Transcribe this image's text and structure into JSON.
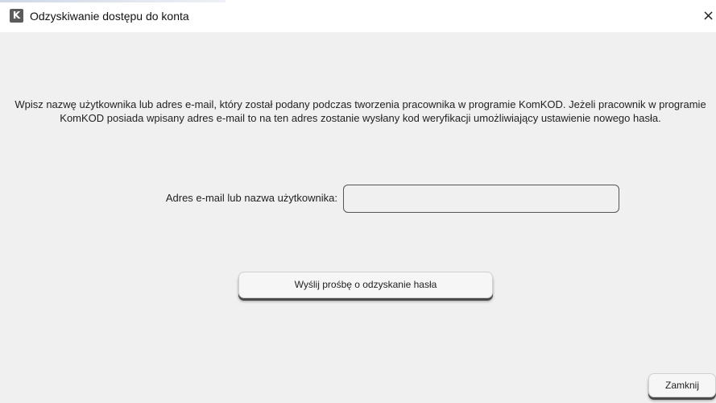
{
  "window": {
    "icon_letter": "K",
    "title": "Odzyskiwanie dostępu do konta",
    "close_glyph": "×"
  },
  "main": {
    "instructions": "Wpisz nazwę użytkownika lub adres e-mail, który został podany podczas tworzenia pracownika w programie KomKOD. Jeżeli pracownik w programie KomKOD posiada wpisany adres e-mail to na ten adres zostanie wysłany kod weryfikacji umożliwiający ustawienie nowego hasła.",
    "field_label": "Adres e-mail lub nazwa użytkownika:",
    "field_value": "",
    "send_button": "Wyślij prośbę o odzyskanie hasła",
    "close_button": "Zamknij"
  },
  "icons": {
    "app": "app-logo-icon",
    "close": "close-icon"
  },
  "colors": {
    "background": "#f0f0f0",
    "titlebar": "#ffffff",
    "icon_bg": "#5b5b5b"
  }
}
